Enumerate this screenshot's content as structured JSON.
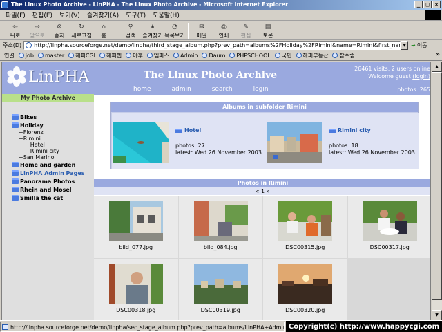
{
  "window": {
    "title": "The Linux Photo Archive - LinPHA - The Linux Photo Archive - Microsoft Internet Explorer",
    "buttons": {
      "minimize": "_",
      "maximize": "□",
      "close": "×"
    }
  },
  "menu": [
    "파일(F)",
    "편집(E)",
    "보기(V)",
    "즐겨찾기(A)",
    "도구(T)",
    "도움말(H)"
  ],
  "toolbar": [
    {
      "label": "뒤로",
      "icon": "back-arrow-icon",
      "glyph": "⇦",
      "disabled": false
    },
    {
      "label": "앞으로",
      "icon": "forward-arrow-icon",
      "glyph": "⇨",
      "disabled": true
    },
    {
      "label": "중지",
      "icon": "stop-icon",
      "glyph": "⊗",
      "disabled": false
    },
    {
      "label": "새로고침",
      "icon": "refresh-icon",
      "glyph": "↻",
      "disabled": false
    },
    {
      "label": "홈",
      "icon": "home-icon",
      "glyph": "⌂",
      "disabled": false
    },
    {
      "label": "검색",
      "icon": "search-icon",
      "glyph": "⚲",
      "disabled": false
    },
    {
      "label": "즐겨찾기",
      "icon": "favorites-icon",
      "glyph": "★",
      "disabled": false
    },
    {
      "label": "목록보기",
      "icon": "history-icon",
      "glyph": "◔",
      "disabled": false
    },
    {
      "label": "메일",
      "icon": "mail-icon",
      "glyph": "✉",
      "disabled": false
    },
    {
      "label": "인쇄",
      "icon": "print-icon",
      "glyph": "⎙",
      "disabled": false
    },
    {
      "label": "편집",
      "icon": "edit-icon",
      "glyph": "✎",
      "disabled": true
    },
    {
      "label": "토론",
      "icon": "discuss-icon",
      "glyph": "▤",
      "disabled": false
    }
  ],
  "address": {
    "label": "주소(D)",
    "value": "http://linpha.sourceforge.net/demo/linpha/third_stage_album.php?prev_path=albums%2FHoliday%2FRimini&name=Rimini&first_name=Holiday",
    "go": "이동"
  },
  "links": {
    "label": "연결",
    "items": [
      "job",
      "master",
      "해피CGI",
      "해피쳅",
      "야후",
      "엠파스",
      "Admin",
      "Daum",
      "PHPSCHOOL",
      "국민",
      "해피부동산",
      "잡수랩"
    ]
  },
  "site": {
    "logo": "LinPHA",
    "title": "The Linux Photo Archive",
    "visits": "26461 visits, 2 users online",
    "welcome": "Welcome guest",
    "login_paren": "(login)",
    "nav": [
      "home",
      "admin",
      "search",
      "login"
    ],
    "photos_count": "photos: 265"
  },
  "sidebar": {
    "title": "My Photo Archive",
    "tree": [
      {
        "kind": "folder",
        "label": "Bikes"
      },
      {
        "kind": "folder",
        "label": "Holiday"
      },
      {
        "kind": "sub",
        "label": "+Florenz"
      },
      {
        "kind": "sub",
        "label": "+Rimini"
      },
      {
        "kind": "sub2",
        "label": "+Hotel"
      },
      {
        "kind": "sub2",
        "label": "+Rimini city"
      },
      {
        "kind": "sub",
        "label": "+San Marino"
      },
      {
        "kind": "folder",
        "label": "Home and garden"
      },
      {
        "kind": "link",
        "label": "LinPHA Admin Pages"
      },
      {
        "kind": "folder",
        "label": "Panorama Photos"
      },
      {
        "kind": "folder",
        "label": "Rhein and Mosel"
      },
      {
        "kind": "folder",
        "label": "Smilla the cat"
      }
    ]
  },
  "subfolders": {
    "title": "Albums in subfolder Rimini",
    "items": [
      {
        "name": "Hotel",
        "photos": "photos: 27",
        "latest": "latest: Wed 26 November 2003"
      },
      {
        "name": "Rimini city",
        "photos": "photos: 18",
        "latest": "latest: Wed 26 November 2003"
      }
    ]
  },
  "photos": {
    "title": "Photos in Rimini",
    "pager": "« 1 »",
    "items": [
      "bild_077.jpg",
      "bild_084.jpg",
      "DSC00315.jpg",
      "DSC00317.jpg",
      "DSC00318.jpg",
      "DSC00319.jpg",
      "DSC00320.jpg"
    ]
  },
  "status": {
    "text": "http://linpha.sourceforge.net/demo/linpha/sec_stage_album.php?prev_path=albums/LinPHA+Admin+Pages&name",
    "copyright": "Copyright(c) http://www.happycgi.com"
  }
}
